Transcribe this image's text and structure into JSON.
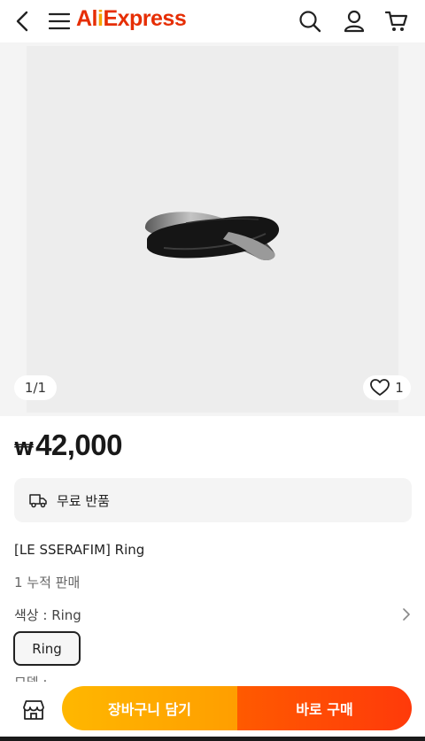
{
  "header": {
    "logo_text": "AliExpress",
    "icons": [
      "back-arrow-icon",
      "menu-icon",
      "search-icon",
      "account-icon",
      "cart-icon"
    ]
  },
  "gallery": {
    "counter": "1/1",
    "wishlist_count": "1"
  },
  "product": {
    "currency": "₩",
    "price": "42,000",
    "free_return": "무료 반품",
    "title": "[LE SSERAFIM] Ring",
    "sold": "1 누적 판매",
    "variant_label": "색상 : Ring",
    "variant_option": "Ring",
    "next_section_peek": "모델 : -"
  },
  "bottom_bar": {
    "add_to_cart": "장바구니 담기",
    "buy_now": "바로 구매"
  },
  "colors": {
    "brand": "#e62e04",
    "cart_button": "#ffa800",
    "buy_button": "#ff4a06"
  }
}
